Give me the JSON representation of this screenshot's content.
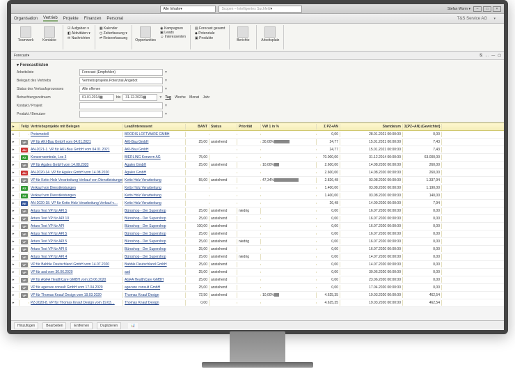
{
  "title": {
    "allContents": "Alle Inhalte",
    "searchPlaceholder": "Scopen – Intelligentes Suchfeld",
    "user": "Stefan Worm",
    "company": "T&S Service AG"
  },
  "menu": {
    "items": [
      "Organisation",
      "Vertrieb",
      "Projekte",
      "Finanzen",
      "Personal"
    ],
    "active": 1
  },
  "ribbon": {
    "g1": {
      "teamwork": "Teamwork",
      "contacts": "Kontakte"
    },
    "g2": [
      "Aufgaben",
      "Aktivitäten",
      "Nachrichten"
    ],
    "g3": [
      "Kalender",
      "Zeiterfassung",
      "Reiseerfassung"
    ],
    "g4": {
      "opp": "Opportunities",
      "items": [
        "Kampagnen",
        "Leads",
        "Interessenten"
      ]
    },
    "g5": [
      "Forecast gesamt",
      "Potenziale",
      "Produkte"
    ],
    "g6": {
      "reports": "Berichte"
    },
    "g7": {
      "workspace": "Arbeitsplatz"
    }
  },
  "crumb": {
    "path": "Forecast"
  },
  "filters": {
    "heading": "Forecastlisten",
    "arbeitsliste": {
      "label": "Arbeitsliste",
      "value": "Forecast (Empfohlen)"
    },
    "belegart": {
      "label": "Belegart des Vertriebs",
      "value": "Vertriebsprojekte,Potenzial,Angebot"
    },
    "status": {
      "label": "Status des Verkaufsprozesses",
      "value": "Alle offenen"
    },
    "zeitraum": {
      "label": "Betrachtungszeitraum",
      "from": "01.01.2014",
      "to": "31.12.2021",
      "tabs": [
        "Tag",
        "Woche",
        "Monat",
        "Jahr"
      ],
      "tabActive": 0,
      "bis": "bis"
    },
    "kontakt": {
      "label": "Kontakt / Projekt"
    },
    "produkt": {
      "label": "Produkt / Benutzer"
    }
  },
  "columns": [
    "",
    "Teilprojekt",
    "Vertriebsprojekte mit Belegen",
    "Lead/Interessent",
    "BANT",
    "Status",
    "Priorität",
    "VW 1 in %",
    "Σ PZ+AN",
    "Startdatum",
    "Σ(PZ+AN) (Gewichtet)"
  ],
  "rows": [
    {
      "t": "",
      "name": "Preismodell",
      "lead": "BRODIS LOFTWARE GMBH",
      "bant": "",
      "status": "",
      "prio": "",
      "vw": "",
      "sum": "0,00",
      "date": "28.01.2021 00:00:00",
      "gw": "0,00"
    },
    {
      "t": "VP",
      "name": "VP für AKI-Bau GmbH vom 04.01.2021",
      "lead": "AKI-Bau GmbH",
      "bant": "25,00",
      "status": "anstehend",
      "prio": "",
      "vw": "30,00%",
      "sum": "24,77",
      "date": "15.01.2021 00:00:00",
      "gw": "7,43"
    },
    {
      "t": "AN",
      "name": "AN-2021-1. VP für AKI-Bau GmbH vom 04.01.2021",
      "lead": "AKI-Bau GmbH",
      "bant": "",
      "status": "",
      "prio": "",
      "vw": "",
      "sum": "24,77",
      "date": "15.01.2021 00:00:00",
      "gw": "7,43"
    },
    {
      "t": "PZ",
      "name": "Konzernzentrale, Los 3",
      "lead": "BIERLING Konzern AG",
      "bant": "75,00",
      "status": "",
      "prio": "",
      "vw": "",
      "sum": "70.000,00",
      "date": "31.12.2014 00:00:00",
      "gw": "63.000,00"
    },
    {
      "t": "VP",
      "name": "VP für Agalex GmbH vom 14.08.2020",
      "lead": "Agalex GmbH",
      "bant": "25,00",
      "status": "anstehend",
      "prio": "",
      "vw": "10,00%",
      "sum": "2.600,00",
      "date": "14.08.2020 00:00:00",
      "gw": "260,00"
    },
    {
      "t": "AN",
      "name": "AN-2020-14. VP für Agalex GmbH vom 14.08.2020",
      "lead": "Agalex GmbH",
      "bant": "",
      "status": "",
      "prio": "",
      "vw": "",
      "sum": "2.600,00",
      "date": "14.08.2020 00:00:00",
      "gw": "260,00"
    },
    {
      "t": "VP",
      "name": "VP für Ketto Holz Verarbeitung Verkauf von Dienstleistungen",
      "lead": "Ketto Holz Verarbeitung",
      "bant": "55,00",
      "status": "anstehend",
      "prio": "",
      "vw": "47,34%",
      "sum": "2.826,48",
      "date": "03.08.2020 00:00:00",
      "gw": "1.337,94"
    },
    {
      "t": "PZ",
      "name": "Verkauf von Dienstleistungen",
      "lead": "Ketto Holz Verarbeitung",
      "bant": "",
      "status": "",
      "prio": "",
      "vw": "",
      "sum": "1.400,00",
      "date": "03.08.2020 00:00:00",
      "gw": "1.190,00"
    },
    {
      "t": "PZ",
      "name": "Verkauf von Dienstleistungen",
      "lead": "Ketto Holz Verarbeitung",
      "bant": "",
      "status": "",
      "prio": "",
      "vw": "",
      "sum": "1.400,00",
      "date": "03.08.2020 00:00:00",
      "gw": "140,00"
    },
    {
      "t": "RE",
      "name": "AN-2020-18. VP für Ketto Holz Verarbeitung Verkauf v…",
      "lead": "Ketto Holz Verarbeitung",
      "bant": "",
      "status": "",
      "prio": "",
      "vw": "",
      "sum": "26,48",
      "date": "14.09.2020 00:00:00",
      "gw": "7,94"
    },
    {
      "t": "VP",
      "name": "Arturs Test VP für API 5",
      "lead": "Büroshop - Der Supershop",
      "bant": "25,00",
      "status": "anstehend",
      "prio": "niedrig",
      "vw": "",
      "sum": "0,00",
      "date": "16.07.2020 00:00:00",
      "gw": "0,00"
    },
    {
      "t": "VP",
      "name": "Arturs Test VP für API 10",
      "lead": "Büroshop - Der Supershop",
      "bant": "25,00",
      "status": "anstehend",
      "prio": "",
      "vw": "",
      "sum": "0,00",
      "date": "16.07.2020 00:00:00",
      "gw": "0,00"
    },
    {
      "t": "VP",
      "name": "Arturs Test VP für API",
      "lead": "Büroshop - Der Supershop",
      "bant": "100,00",
      "status": "anstehend",
      "prio": "",
      "vw": "",
      "sum": "0,00",
      "date": "16.07.2020 00:00:00",
      "gw": "0,00"
    },
    {
      "t": "VP",
      "name": "Arturs Test VP für API 5",
      "lead": "Büroshop - Der Supershop",
      "bant": "25,00",
      "status": "anstehend",
      "prio": "",
      "vw": "",
      "sum": "0,00",
      "date": "16.07.2020 00:00:00",
      "gw": "0,00"
    },
    {
      "t": "VP",
      "name": "Arturs Test VP für API 5",
      "lead": "Büroshop - Der Supershop",
      "bant": "25,00",
      "status": "anstehend",
      "prio": "niedrig",
      "vw": "",
      "sum": "0,00",
      "date": "16.07.2020 00:00:00",
      "gw": "0,00"
    },
    {
      "t": "VP",
      "name": "Arturs Test VP für API 6",
      "lead": "Büroshop - Der Supershop",
      "bant": "25,00",
      "status": "anstehend",
      "prio": "",
      "vw": "",
      "sum": "0,00",
      "date": "16.07.2020 00:00:00",
      "gw": "0,00"
    },
    {
      "t": "VP",
      "name": "Arturs Test VP für API 4",
      "lead": "Büroshop - Der Supershop",
      "bant": "25,00",
      "status": "anstehend",
      "prio": "niedrig",
      "vw": "",
      "sum": "0,00",
      "date": "14.07.2020 00:00:00",
      "gw": "0,00"
    },
    {
      "t": "VP",
      "name": "VP für Babble Deutschland GmbH vom 14.07.2020",
      "lead": "Babble Deutschland GmbH",
      "bant": "25,00",
      "status": "anstehend",
      "prio": "",
      "vw": "",
      "sum": "0,00",
      "date": "14.07.2020 00:00:00",
      "gw": "0,00"
    },
    {
      "t": "VP",
      "name": "VP für asd vom 30.06.2020",
      "lead": "asd",
      "bant": "25,00",
      "status": "anstehend",
      "prio": "",
      "vw": "",
      "sum": "0,00",
      "date": "30.06.2020 00:00:00",
      "gw": "0,00"
    },
    {
      "t": "VP",
      "name": "VP für AGFA HealthCare GMBH vom 23.06.2020",
      "lead": "AGFA HealthCare GMBH",
      "bant": "25,00",
      "status": "anstehend",
      "prio": "",
      "vw": "",
      "sum": "0,00",
      "date": "23.06.2020 00:00:00",
      "gw": "0,00"
    },
    {
      "t": "VP",
      "name": "VP für agecare consult GmbH vom 17.04.2020",
      "lead": "agecare consult GmbH",
      "bant": "25,00",
      "status": "anstehend",
      "prio": "",
      "vw": "",
      "sum": "0,00",
      "date": "17.04.2020 00:00:00",
      "gw": "0,00"
    },
    {
      "t": "VP",
      "name": "VP für Thomas Knauf Design vom 19.03.2020",
      "lead": "Thomas Knauf Design",
      "bant": "72,50",
      "status": "anstehend",
      "prio": "",
      "vw": "10,00%",
      "sum": "4.625,35",
      "date": "19.03.2020 00:00:00",
      "gw": "462,54"
    },
    {
      "t": "",
      "name": "PZ-2020-8. VP für Thomas Knauf Design vom 19.03…",
      "lead": "Thomas Knauf Design",
      "bant": "0,00",
      "status": "",
      "prio": "",
      "vw": "",
      "sum": "4.625,35",
      "date": "19.03.2020 00:00:00",
      "gw": "462,54"
    }
  ],
  "bottom": {
    "b1": "Hinzufügen",
    "b2": "Bearbeiten",
    "b3": "Entfernen",
    "b4": "Duplizieren"
  }
}
